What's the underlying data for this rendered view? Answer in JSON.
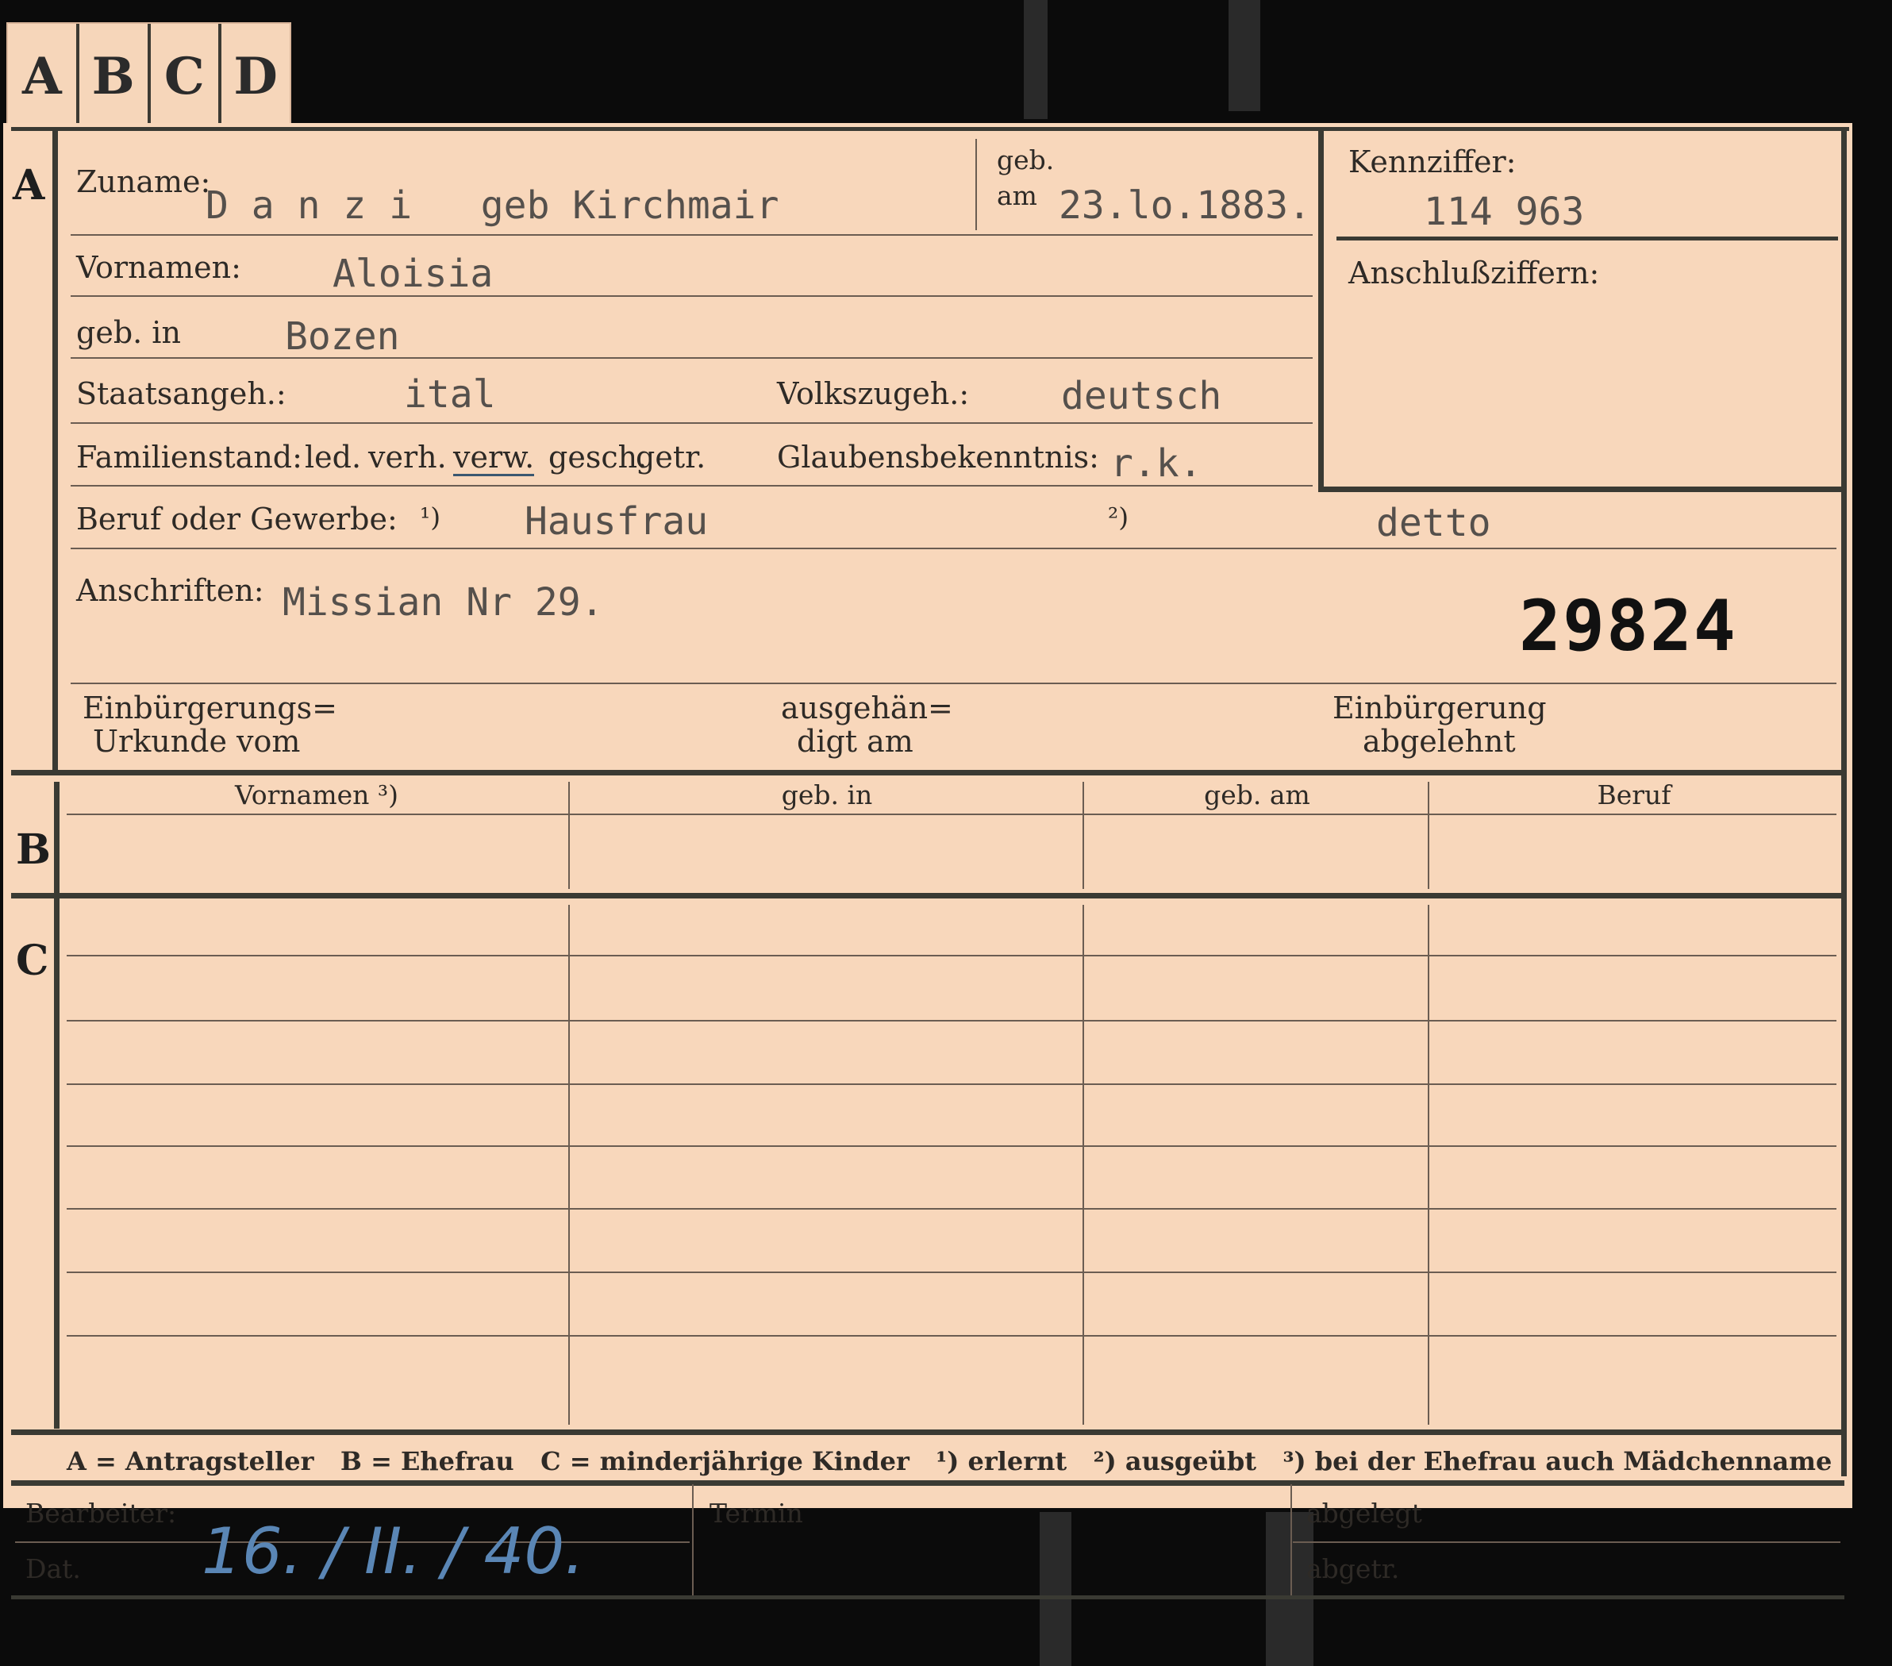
{
  "tabs": [
    "A",
    "B",
    "C",
    "D"
  ],
  "section_letters": {
    "a": "A",
    "b": "B",
    "c": "C"
  },
  "labels": {
    "zuname": "Zuname:",
    "geb_am_1": "geb.",
    "geb_am_2": "am",
    "kennziffer": "Kennziffer:",
    "anschlussziffern": "Anschlußziffern:",
    "vornamen": "Vornamen:",
    "geb_in": "geb. in",
    "staatsangeh": "Staatsangeh.:",
    "volkszugeh": "Volkszugeh.:",
    "familienstand": "Familienstand:",
    "familienstand_options": [
      "led.",
      "verh.",
      "verw.",
      "gesch.",
      "getr."
    ],
    "glaubensbekenntnis": "Glaubensbekenntnis:",
    "beruf": "Beruf oder Gewerbe:",
    "beruf_note1": "¹)",
    "beruf_note2": "²)",
    "anschriften": "Anschriften:",
    "einbuergerung_1": "Einbürgerungs=",
    "einbuergerung_2": "Urkunde vom",
    "ausgehaendigt_1": "ausgehän=",
    "ausgehaendigt_2": "digt am",
    "abgelehnt_1": "Einbürgerung",
    "abgelehnt_2": "abgelehnt",
    "bearbeiter": "Bearbeiter:",
    "dat": "Dat.",
    "termin": "Termin",
    "abgelegt": "abgelegt",
    "abgetr": "abgetr."
  },
  "values": {
    "zuname": "D a n z i   geb Kirchmair",
    "geb_am": "23.lo.1883.",
    "kennziffer": "114 963",
    "vornamen": "Aloisia",
    "geb_in": "Bozen",
    "staatsangeh": "ital",
    "volkszugeh": "deutsch",
    "familienstand_selected": "verw.",
    "glaubensbekenntnis": "r.k.",
    "beruf_erlernt": "Hausfrau",
    "beruf_ausgeuebt": "detto",
    "anschrift": "Missian Nr 29.",
    "stamp_number": "29824",
    "dat_handwritten": "16. / II. / 40."
  },
  "table_headers": [
    "Vornamen ³)",
    "geb. in",
    "geb. am",
    "Beruf"
  ],
  "footer_legend": "A = Antragsteller   B = Ehefrau   C = minderjährige Kinder   ¹) erlernt   ²) ausgeübt   ³) bei der Ehefrau auch Mädchenname"
}
